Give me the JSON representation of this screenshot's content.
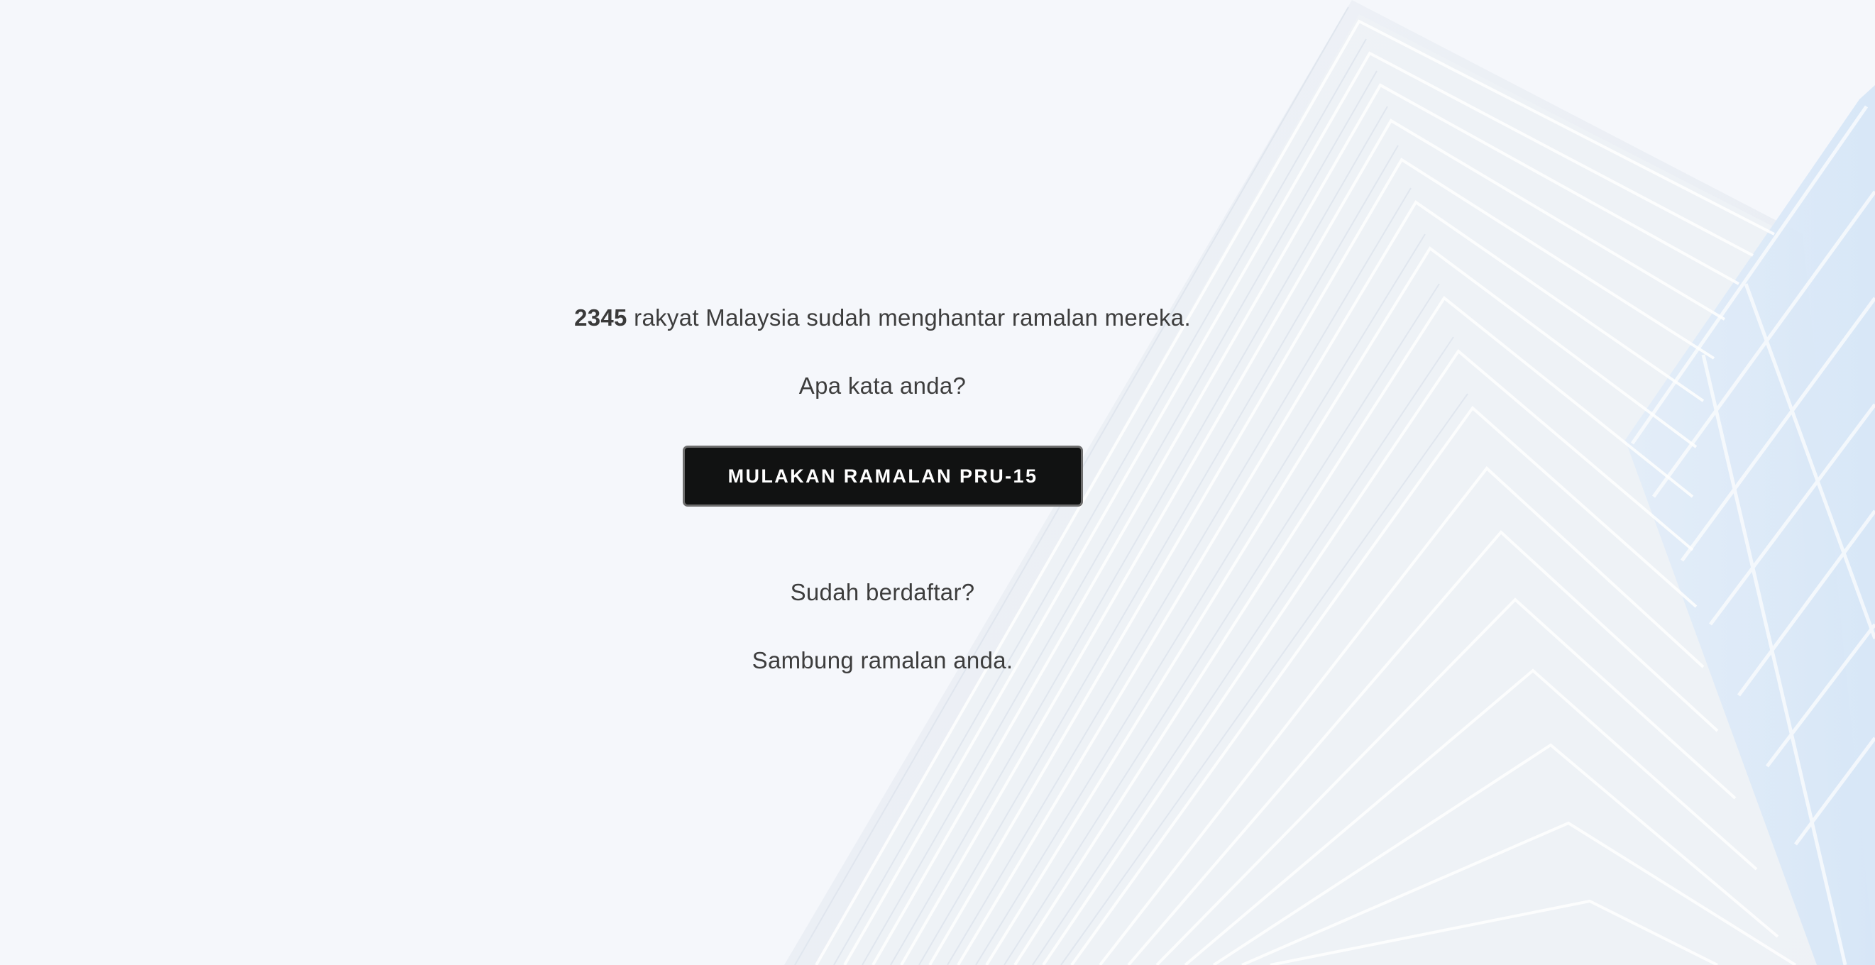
{
  "stats": {
    "count": "2345",
    "count_suffix": " rakyat Malaysia sudah menghantar ramalan mereka."
  },
  "prompt": {
    "question": "Apa kata anda?"
  },
  "cta": {
    "label": "MULAKAN RAMALAN PRU-15"
  },
  "returning": {
    "question": "Sudah berdaftar?",
    "link_text": "Sambung ramalan anda."
  },
  "colors": {
    "background": "#f5f7fb",
    "text": "#3d3d3d",
    "button_bg": "#111212",
    "button_text": "#ffffff"
  },
  "background_image": {
    "icon": "skyscraper-illustration"
  }
}
